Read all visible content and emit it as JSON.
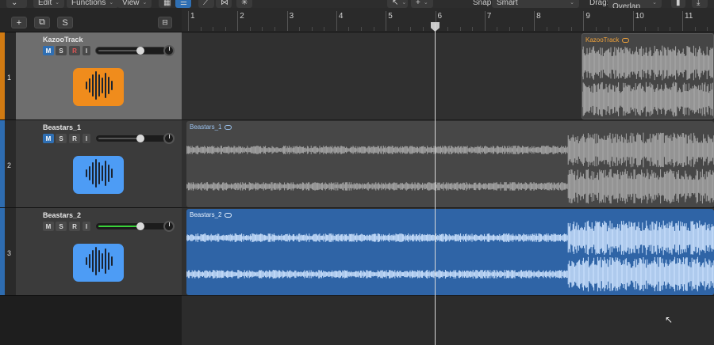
{
  "menubar": {
    "edit": "Edit",
    "functions": "Functions",
    "view": "View",
    "snap_label": "Snap:",
    "snap_value": "Smart",
    "drag_label": "Drag:",
    "drag_value": "No Overlap"
  },
  "header_buttons": {
    "add": "+",
    "duplicate": "⧉",
    "s": "S"
  },
  "ruler": {
    "bars": [
      "1",
      "2",
      "3",
      "4",
      "5",
      "6",
      "7",
      "8",
      "9",
      "10",
      "11"
    ]
  },
  "tracks": [
    {
      "number": "1",
      "name": "KazooTrack",
      "color": "#d07a12",
      "icon_color": "#f08c1c",
      "mute": "M",
      "solo": "S",
      "record": "R",
      "input": "I",
      "mute_on": true,
      "record_armed": true,
      "volume_level": 0.68,
      "region": {
        "name": "KazooTrack",
        "color": "#454545",
        "text_color": "#f0a23a"
      }
    },
    {
      "number": "2",
      "name": "Beastars_1",
      "color": "#2e6cb0",
      "icon_color": "#4d9cf5",
      "mute": "M",
      "solo": "S",
      "record": "R",
      "input": "I",
      "mute_on": true,
      "record_armed": false,
      "volume_level": 0.68,
      "region": {
        "name": "Beastars_1",
        "color": "#474747",
        "text_color": "#9cc4f0"
      }
    },
    {
      "number": "3",
      "name": "Beastars_2",
      "color": "#2e6cb0",
      "icon_color": "#4d9cf5",
      "mute": "M",
      "solo": "S",
      "record": "R",
      "input": "I",
      "mute_on": false,
      "record_armed": false,
      "volume_level": 0.68,
      "region": {
        "name": "Beastars_2",
        "color": "#2f64a6",
        "text_color": "#e8f2ff"
      }
    }
  ],
  "icons": {
    "waveform": "waveform-icon",
    "pointer": "pointer-tool-icon",
    "marquee": "marquee-tool-icon"
  }
}
